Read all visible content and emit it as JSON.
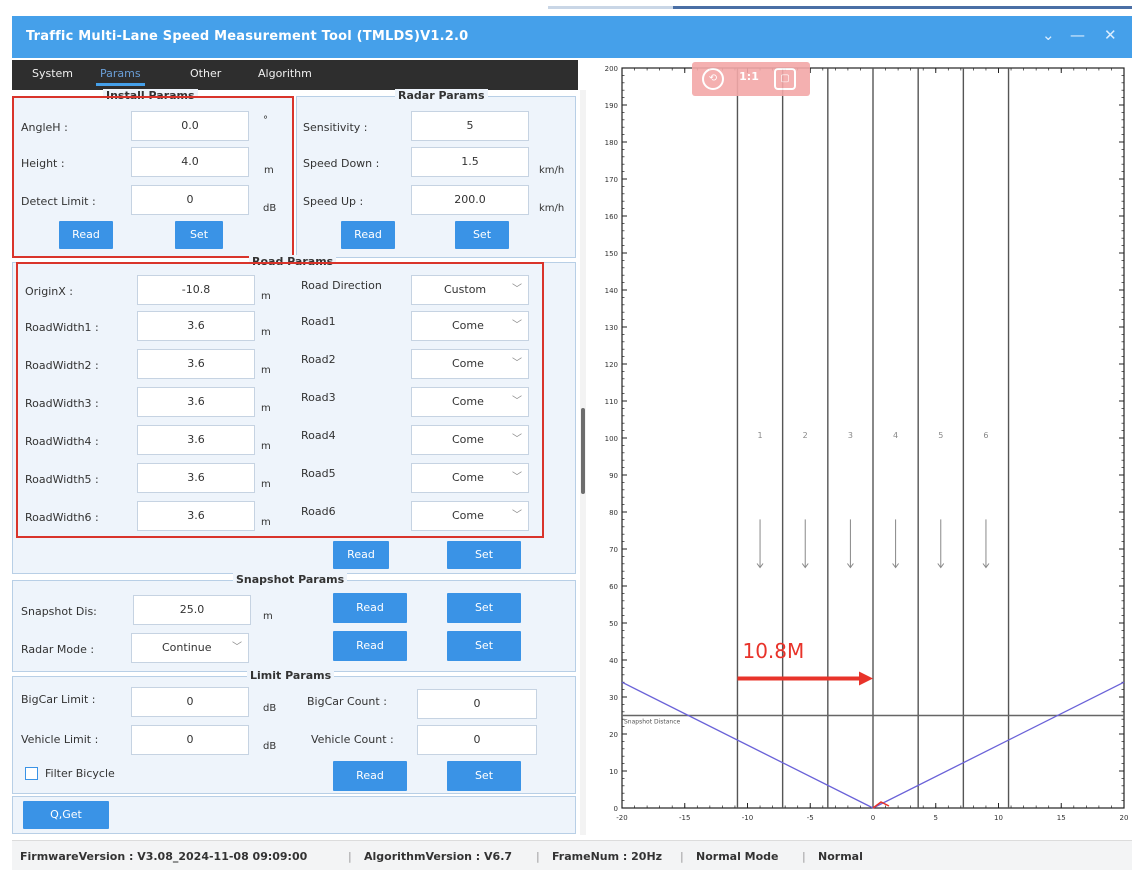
{
  "window": {
    "title": "Traffic Multi-Lane Speed Measurement Tool (TMLDS)V1.2.0",
    "controls": [
      "⌄",
      "—",
      "✕"
    ]
  },
  "tabs": [
    "System",
    "Params",
    "Other",
    "Algorithm"
  ],
  "active_tab": "Params",
  "install": {
    "title": "Install Params",
    "angleh_label": "AngleH :",
    "angleh_value": "0.0",
    "angleh_unit": "°",
    "height_label": "Height :",
    "height_value": "4.0",
    "height_unit": "m",
    "detect_label": "Detect Limit :",
    "detect_value": "0",
    "detect_unit": "dB",
    "read": "Read",
    "set": "Set"
  },
  "radar": {
    "title": "Radar Params",
    "sens_label": "Sensitivity :",
    "sens_value": "5",
    "down_label": "Speed Down :",
    "down_value": "1.5",
    "down_unit": "km/h",
    "up_label": "Speed Up :",
    "up_value": "200.0",
    "up_unit": "km/h",
    "read": "Read",
    "set": "Set"
  },
  "road": {
    "title": "Road Params",
    "originx_label": "OriginX :",
    "originx_value": "-10.8",
    "originx_unit": "m",
    "direction_label": "Road Direction",
    "direction_value": "Custom",
    "widths": [
      {
        "label": "RoadWidth1 :",
        "value": "3.6",
        "unit": "m"
      },
      {
        "label": "RoadWidth2 :",
        "value": "3.6",
        "unit": "m"
      },
      {
        "label": "RoadWidth3 :",
        "value": "3.6",
        "unit": "m"
      },
      {
        "label": "RoadWidth4 :",
        "value": "3.6",
        "unit": "m"
      },
      {
        "label": "RoadWidth5 :",
        "value": "3.6",
        "unit": "m"
      },
      {
        "label": "RoadWidth6 :",
        "value": "3.6",
        "unit": "m"
      }
    ],
    "roads": [
      {
        "label": "Road1",
        "value": "Come"
      },
      {
        "label": "Road2",
        "value": "Come"
      },
      {
        "label": "Road3",
        "value": "Come"
      },
      {
        "label": "Road4",
        "value": "Come"
      },
      {
        "label": "Road5",
        "value": "Come"
      },
      {
        "label": "Road6",
        "value": "Come"
      }
    ],
    "read": "Read",
    "set": "Set"
  },
  "snapshot": {
    "title": "Snapshot Params",
    "dis_label": "Snapshot Dis:",
    "dis_value": "25.0",
    "dis_unit": "m",
    "mode_label": "Radar Mode :",
    "mode_value": "Continue",
    "read": "Read",
    "set": "Set"
  },
  "limit": {
    "title": "Limit Params",
    "bigcar_label": "BigCar Limit :",
    "bigcar_value": "0",
    "bigcar_unit": "dB",
    "bigcount_label": "BigCar Count :",
    "bigcount_value": "0",
    "vehicle_label": "Vehicle Limit :",
    "vehicle_value": "0",
    "vehicle_unit": "dB",
    "vcount_label": "Vehicle Count :",
    "vcount_value": "0",
    "bicycle_label": "Filter Bicycle",
    "bicycle_checked": false,
    "read": "Read",
    "set": "Set"
  },
  "get_button": "Q,Get",
  "chart_toolbar": [
    "⟲",
    "1:1",
    "▢"
  ],
  "status": {
    "firmware": "FirmwareVersion : V3.08_2024-11-08 09:09:00",
    "algorithm": "AlgorithmVersion : V6.7",
    "frame": "FrameNum : 20Hz",
    "mode": "Normal Mode",
    "state": "Normal",
    "sep": "|"
  },
  "chart_data": {
    "type": "scatter",
    "x_range": [
      -20,
      20
    ],
    "y_range": [
      0,
      200
    ],
    "x_ticks": [
      -20,
      -15,
      -10,
      -5,
      0,
      5,
      10,
      15,
      20
    ],
    "y_ticks": [
      0,
      10,
      20,
      30,
      40,
      50,
      60,
      70,
      80,
      90,
      100,
      110,
      120,
      130,
      140,
      150,
      160,
      170,
      180,
      190,
      200
    ],
    "lane_lines_x": [
      -10.8,
      -7.2,
      -3.6,
      0,
      3.6,
      7.2,
      10.8
    ],
    "lane_labels": [
      "1",
      "2",
      "3",
      "4",
      "5",
      "6"
    ],
    "lane_label_y": 100,
    "lane_arrow_y": [
      78,
      65
    ],
    "snapshot_line": {
      "y": 25,
      "label": "Snapshot Distance"
    },
    "fov_left": [
      [
        -20,
        34
      ],
      [
        0,
        0
      ]
    ],
    "fov_right": [
      [
        0,
        0
      ],
      [
        20,
        34
      ]
    ],
    "annotation": {
      "text": "10.8M",
      "arrow_from": [
        -10.8,
        35
      ],
      "arrow_to": [
        0,
        35
      ]
    },
    "colors": {
      "lane": "#555555",
      "fov": "#6a62d8",
      "snapshot": "#666666",
      "annotation": "#e8332a",
      "arrow": "#888888"
    }
  }
}
